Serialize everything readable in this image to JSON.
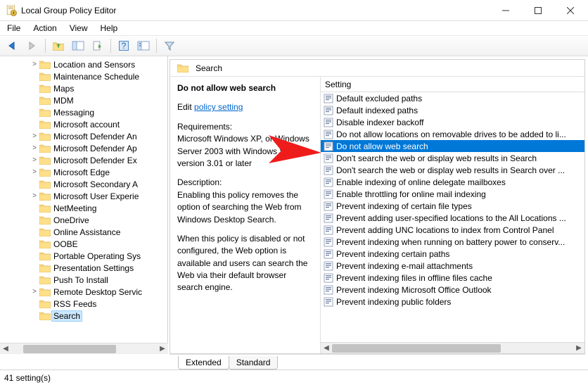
{
  "window": {
    "title": "Local Group Policy Editor"
  },
  "menu": [
    "File",
    "Action",
    "View",
    "Help"
  ],
  "tree": [
    {
      "label": "Location and Sensors",
      "exp": ">"
    },
    {
      "label": "Maintenance Schedule",
      "exp": ""
    },
    {
      "label": "Maps",
      "exp": ""
    },
    {
      "label": "MDM",
      "exp": ""
    },
    {
      "label": "Messaging",
      "exp": ""
    },
    {
      "label": "Microsoft account",
      "exp": ""
    },
    {
      "label": "Microsoft Defender An",
      "exp": ">"
    },
    {
      "label": "Microsoft Defender Ap",
      "exp": ">"
    },
    {
      "label": "Microsoft Defender Ex",
      "exp": ">"
    },
    {
      "label": "Microsoft Edge",
      "exp": ">"
    },
    {
      "label": "Microsoft Secondary A",
      "exp": ""
    },
    {
      "label": "Microsoft User Experie",
      "exp": ">"
    },
    {
      "label": "NetMeeting",
      "exp": ""
    },
    {
      "label": "OneDrive",
      "exp": ""
    },
    {
      "label": "Online Assistance",
      "exp": ""
    },
    {
      "label": "OOBE",
      "exp": ""
    },
    {
      "label": "Portable Operating Sys",
      "exp": ""
    },
    {
      "label": "Presentation Settings",
      "exp": ""
    },
    {
      "label": "Push To Install",
      "exp": ""
    },
    {
      "label": "Remote Desktop Servic",
      "exp": ">"
    },
    {
      "label": "RSS Feeds",
      "exp": ""
    },
    {
      "label": "Search",
      "exp": "",
      "sel": true
    }
  ],
  "breadcrumb": "Search",
  "details": {
    "title": "Do not allow web search",
    "edit_label": "Edit",
    "edit_link": "policy setting ",
    "requirements_label": "Requirements:",
    "requirements_text": "Microsoft Windows XP, or Windows Server 2003 with Windows Search version 3.01 or later",
    "description_label": "Description:",
    "description_text1": "Enabling this policy removes the option of searching the Web from Windows Desktop Search.",
    "description_text2": "When this policy is disabled or not configured, the Web option is available and users can search the Web via their default browser search engine."
  },
  "list": {
    "header": "Setting",
    "items": [
      "Default excluded paths",
      "Default indexed paths",
      "Disable indexer backoff",
      "Do not allow locations on removable drives to be added to li...",
      "Do not allow web search",
      "Don't search the web or display web results in Search",
      "Don't search the web or display web results in Search over ...",
      "Enable indexing of online delegate mailboxes",
      "Enable throttling for online mail indexing",
      "Prevent indexing of certain file types",
      "Prevent adding user-specified locations to the All Locations ...",
      "Prevent adding UNC locations to index from Control Panel",
      "Prevent indexing when running on battery power to conserv...",
      "Prevent indexing certain paths",
      "Prevent indexing e-mail attachments",
      "Prevent indexing files in offline files cache",
      "Prevent indexing Microsoft Office Outlook",
      "Prevent indexing public folders"
    ],
    "selected_index": 4
  },
  "tabs": [
    "Extended",
    "Standard"
  ],
  "status": "41 setting(s)"
}
